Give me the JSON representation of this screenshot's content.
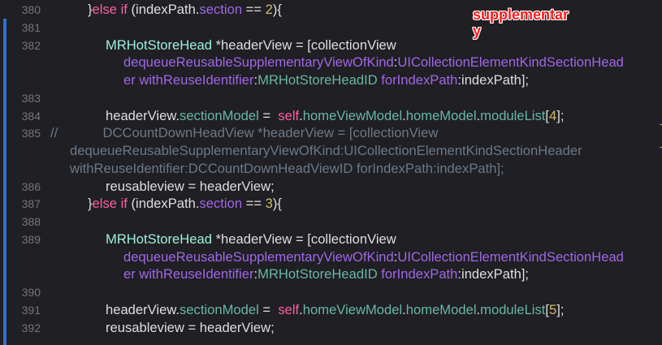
{
  "annotation": {
    "line1": "supplementar",
    "line2": "y"
  },
  "rows": [
    {
      "num": "380",
      "indent": 108,
      "tokens": [
        {
          "t": "}",
          "c": "plain"
        },
        {
          "t": "else if",
          "c": "kw"
        },
        {
          "t": " (indexPath.",
          "c": "plain"
        },
        {
          "t": "section",
          "c": "prop"
        },
        {
          "t": " == ",
          "c": "plain"
        },
        {
          "t": "2",
          "c": "numlit"
        },
        {
          "t": "){",
          "c": "plain"
        }
      ]
    },
    {
      "num": "381",
      "indent": 130,
      "tokens": []
    },
    {
      "num": "382",
      "indent": 130,
      "tokens": [
        {
          "t": "MRHotStoreHead",
          "c": "type"
        },
        {
          "t": " *headerView = [collectionView",
          "c": "plain"
        }
      ]
    },
    {
      "num": "",
      "indent": 152,
      "tokens": [
        {
          "t": "dequeueReusableSupplementaryViewOfKind",
          "c": "prop"
        },
        {
          "t": ":",
          "c": "plain"
        },
        {
          "t": "UICollectionElementKindSectionHead",
          "c": "prop"
        }
      ]
    },
    {
      "num": "",
      "indent": 152,
      "tokens": [
        {
          "t": "er withReuseIdentifier",
          "c": "prop"
        },
        {
          "t": ":",
          "c": "plain"
        },
        {
          "t": "MRHotStoreHeadID",
          "c": "ident"
        },
        {
          "t": " forIndexPath",
          "c": "prop"
        },
        {
          "t": ":indexPath];",
          "c": "plain"
        }
      ]
    },
    {
      "num": "383",
      "indent": 130,
      "tokens": []
    },
    {
      "num": "384",
      "indent": 130,
      "tokens": [
        {
          "t": "headerView.",
          "c": "plain"
        },
        {
          "t": "sectionModel",
          "c": "ident"
        },
        {
          "t": " =  ",
          "c": "plain"
        },
        {
          "t": "self",
          "c": "kw"
        },
        {
          "t": ".",
          "c": "plain"
        },
        {
          "t": "homeViewModel",
          "c": "ident"
        },
        {
          "t": ".",
          "c": "plain"
        },
        {
          "t": "homeModel",
          "c": "ident"
        },
        {
          "t": ".",
          "c": "plain"
        },
        {
          "t": "moduleList",
          "c": "ident"
        },
        {
          "t": "[",
          "c": "plain"
        },
        {
          "t": "4",
          "c": "numlit"
        },
        {
          "t": "];",
          "c": "plain"
        }
      ]
    },
    {
      "num": "385",
      "indent": 62,
      "tokens": [
        {
          "t": "//            DCCountDownHeadView *headerView = [collectionView",
          "c": "cmt"
        }
      ]
    },
    {
      "num": "",
      "indent": 86,
      "tokens": [
        {
          "t": "dequeueReusableSupplementaryViewOfKind:UICollectionElementKindSectionHeader",
          "c": "cmt"
        }
      ]
    },
    {
      "num": "",
      "indent": 86,
      "tokens": [
        {
          "t": "withReuseIdentifier:DCCountDownHeadViewID forIndexPath:indexPath];",
          "c": "cmt"
        }
      ]
    },
    {
      "num": "386",
      "indent": 130,
      "tokens": [
        {
          "t": "reusableview = headerView;",
          "c": "plain"
        }
      ]
    },
    {
      "num": "387",
      "indent": 108,
      "tokens": [
        {
          "t": "}",
          "c": "plain"
        },
        {
          "t": "else if",
          "c": "kw"
        },
        {
          "t": " (indexPath.",
          "c": "plain"
        },
        {
          "t": "section",
          "c": "prop"
        },
        {
          "t": " == ",
          "c": "plain"
        },
        {
          "t": "3",
          "c": "numlit"
        },
        {
          "t": "){",
          "c": "plain"
        }
      ]
    },
    {
      "num": "388",
      "indent": 130,
      "tokens": []
    },
    {
      "num": "389",
      "indent": 130,
      "tokens": [
        {
          "t": "MRHotStoreHead",
          "c": "type"
        },
        {
          "t": " *headerView = [collectionView",
          "c": "plain"
        }
      ]
    },
    {
      "num": "",
      "indent": 152,
      "tokens": [
        {
          "t": "dequeueReusableSupplementaryViewOfKind",
          "c": "prop"
        },
        {
          "t": ":",
          "c": "plain"
        },
        {
          "t": "UICollectionElementKindSectionHead",
          "c": "prop"
        }
      ]
    },
    {
      "num": "",
      "indent": 152,
      "tokens": [
        {
          "t": "er withReuseIdentifier",
          "c": "prop"
        },
        {
          "t": ":",
          "c": "plain"
        },
        {
          "t": "MRHotStoreHeadID",
          "c": "ident"
        },
        {
          "t": " forIndexPath",
          "c": "prop"
        },
        {
          "t": ":indexPath];",
          "c": "plain"
        }
      ]
    },
    {
      "num": "390",
      "indent": 130,
      "tokens": []
    },
    {
      "num": "391",
      "indent": 130,
      "tokens": [
        {
          "t": "headerView.",
          "c": "plain"
        },
        {
          "t": "sectionModel",
          "c": "ident"
        },
        {
          "t": " =  ",
          "c": "plain"
        },
        {
          "t": "self",
          "c": "kw"
        },
        {
          "t": ".",
          "c": "plain"
        },
        {
          "t": "homeViewModel",
          "c": "ident"
        },
        {
          "t": ".",
          "c": "plain"
        },
        {
          "t": "homeModel",
          "c": "ident"
        },
        {
          "t": ".",
          "c": "plain"
        },
        {
          "t": "moduleList",
          "c": "ident"
        },
        {
          "t": "[",
          "c": "plain"
        },
        {
          "t": "5",
          "c": "numlit"
        },
        {
          "t": "];",
          "c": "plain"
        }
      ]
    },
    {
      "num": "392",
      "indent": 130,
      "tokens": [
        {
          "t": "reusableview = headerView;",
          "c": "plain"
        }
      ]
    }
  ]
}
